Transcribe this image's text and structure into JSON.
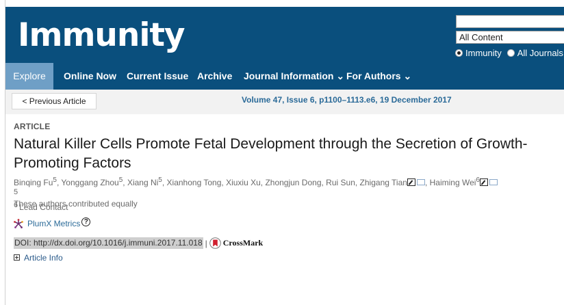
{
  "header": {
    "logo": "Immunity",
    "search": {
      "value": "",
      "scope_selected": "All Content"
    },
    "radios": [
      {
        "label": "Immunity",
        "checked": true
      },
      {
        "label": "All Journals",
        "checked": false
      }
    ]
  },
  "nav": {
    "items": [
      {
        "label": "Explore"
      },
      {
        "label": "Online Now"
      },
      {
        "label": "Current Issue"
      },
      {
        "label": "Archive"
      },
      {
        "label": "Journal Information ⌄"
      },
      {
        "label": "For Authors ⌄"
      }
    ]
  },
  "subbar": {
    "prev_label": "< Previous Article",
    "volume": "Volume 47, Issue 6, p1100–1113.e6, 19 December 2017"
  },
  "article": {
    "kicker": "ARTICLE",
    "title": "Natural Killer Cells Promote Fetal Development through the Secretion of Growth-Promoting Factors",
    "authors": [
      {
        "name": "Binqing Fu",
        "sup": "5"
      },
      {
        "name": "Yonggang Zhou",
        "sup": "5"
      },
      {
        "name": "Xiang Ni",
        "sup": "5"
      },
      {
        "name": "Xianhong Tong"
      },
      {
        "name": "Xiuxiu Xu"
      },
      {
        "name": "Zhongjun Dong"
      },
      {
        "name": "Rui Sun"
      },
      {
        "name": "Zhigang Tian"
      },
      {
        "name": "Haiming Wei",
        "sup": "6"
      }
    ],
    "notes": [
      {
        "sup": "5",
        "text": "These authors contributed equally"
      },
      {
        "sup": "6",
        "text": "Lead Contact"
      }
    ],
    "plumx": "PlumX Metrics",
    "plumx_help": "?",
    "doi": "DOI: http://dx.doi.org/10.1016/j.immuni.2017.11.018",
    "doi_sep": "|",
    "crossmark": "CrossMark",
    "article_info": "Article Info"
  }
}
